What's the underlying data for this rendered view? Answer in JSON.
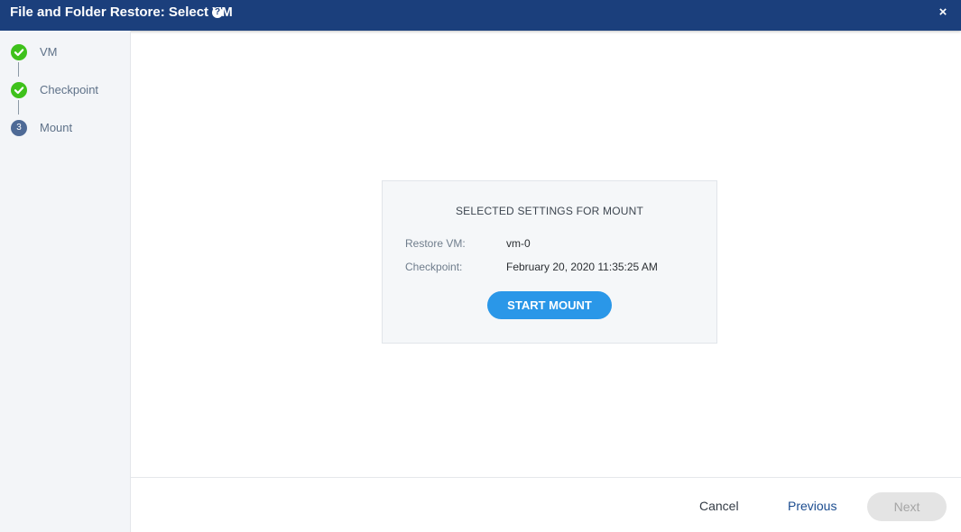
{
  "window": {
    "title": "File and Folder Restore: Select VM",
    "help_icon": "?",
    "close_icon": "×"
  },
  "steps": [
    {
      "label": "VM",
      "status": "done"
    },
    {
      "label": "Checkpoint",
      "status": "done"
    },
    {
      "label": "Mount",
      "status": "current",
      "number": "3"
    }
  ],
  "summary": {
    "heading": "SELECTED SETTINGS FOR MOUNT",
    "rows": [
      {
        "key": "Restore VM:",
        "value": "vm-0"
      },
      {
        "key": "Checkpoint:",
        "value": "February 20, 2020 11:35:25 AM"
      }
    ],
    "start_label": "START MOUNT"
  },
  "footer": {
    "cancel": "Cancel",
    "previous": "Previous",
    "next": "Next",
    "next_disabled": true
  },
  "colors": {
    "titlebar": "#1b3f7c",
    "done": "#3ec11b",
    "current": "#4e6a96",
    "primary_button": "#2a97e8"
  }
}
